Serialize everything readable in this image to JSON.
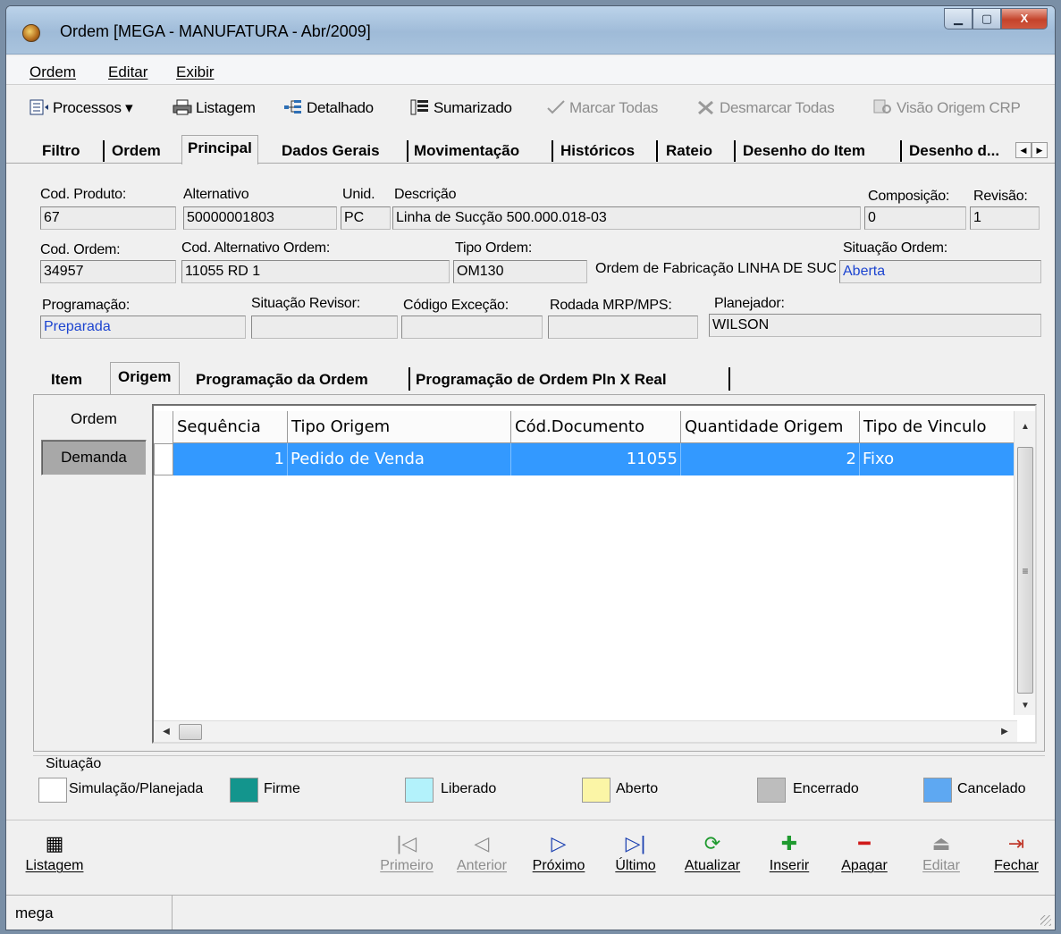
{
  "window": {
    "title": "Ordem [MEGA - MANUFATURA - Abr/2009]",
    "min": "▁",
    "max": "▢",
    "close": "X"
  },
  "menu": [
    "Ordem",
    "Editar",
    "Exibir"
  ],
  "toolbar": {
    "processos": "Processos ▾",
    "listagem": "Listagem",
    "detalhado": "Detalhado",
    "sumarizado": "Sumarizado",
    "marcar_todas": "Marcar Todas",
    "desmarcar_todas": "Desmarcar Todas",
    "visao_origem": "Visão Origem CRP"
  },
  "main_tabs": [
    "Filtro",
    "Ordem",
    "Principal",
    "Dados Gerais",
    "Movimentação",
    "Históricos",
    "Rateio",
    "Desenho do Item",
    "Desenho d..."
  ],
  "fields": {
    "cod_produto": {
      "label": "Cod. Produto:",
      "value": "67"
    },
    "alternativo": {
      "label": "Alternativo",
      "value": "50000001803"
    },
    "unid": {
      "label": "Unid.",
      "value": "PC"
    },
    "descricao": {
      "label": "Descrição",
      "value": "Linha de Sucção 500.000.018-03"
    },
    "composicao": {
      "label": "Composição:",
      "value": "0"
    },
    "revisao": {
      "label": "Revisão:",
      "value": "1"
    },
    "cod_ordem": {
      "label": "Cod. Ordem:",
      "value": "34957"
    },
    "cod_alt_ordem": {
      "label": "Cod. Alternativo Ordem:",
      "value": "11055 RD 1"
    },
    "tipo_ordem": {
      "label": "Tipo Ordem:",
      "value": "OM130",
      "desc": "Ordem de Fabricação LINHA DE SUCCAO"
    },
    "situacao_ordem": {
      "label": "Situação Ordem:",
      "value": "Aberta"
    },
    "programacao": {
      "label": "Programação:",
      "value": "Preparada"
    },
    "situacao_revisor": {
      "label": "Situação Revisor:",
      "value": ""
    },
    "codigo_excecao": {
      "label": "Código Exceção:",
      "value": ""
    },
    "rodada_mrp": {
      "label": "Rodada MRP/MPS:",
      "value": ""
    },
    "planejador": {
      "label": "Planejador:",
      "value": "WILSON"
    }
  },
  "sub_tabs": [
    "Item",
    "Origem",
    "Programação da Ordem",
    "Programação de Ordem Pln X Real"
  ],
  "side_buttons": [
    "Ordem",
    "Demanda"
  ],
  "grid": {
    "columns": [
      "Sequência",
      "Tipo Origem",
      "Cód.Documento",
      "Quantidade Origem",
      "Tipo de Vinculo"
    ],
    "rows": [
      [
        "1",
        "Pedido de Venda",
        "11055",
        "2",
        "Fixo"
      ]
    ]
  },
  "legend": {
    "title": "Situação",
    "items": [
      {
        "label": "Simulação/Planejada",
        "color": "#ffffff"
      },
      {
        "label": "Firme",
        "color": "#13958d"
      },
      {
        "label": "Liberado",
        "color": "#b3f2fb"
      },
      {
        "label": "Aberto",
        "color": "#fbf5a6"
      },
      {
        "label": "Encerrado",
        "color": "#bdbdbd"
      },
      {
        "label": "Cancelado",
        "color": "#5ea8f2"
      }
    ]
  },
  "bottom_buttons": [
    "Listagem",
    "Primeiro",
    "Anterior",
    "Próximo",
    "Último",
    "Atualizar",
    "Inserir",
    "Apagar",
    "Editar",
    "Fechar"
  ],
  "status": {
    "user": "mega"
  }
}
